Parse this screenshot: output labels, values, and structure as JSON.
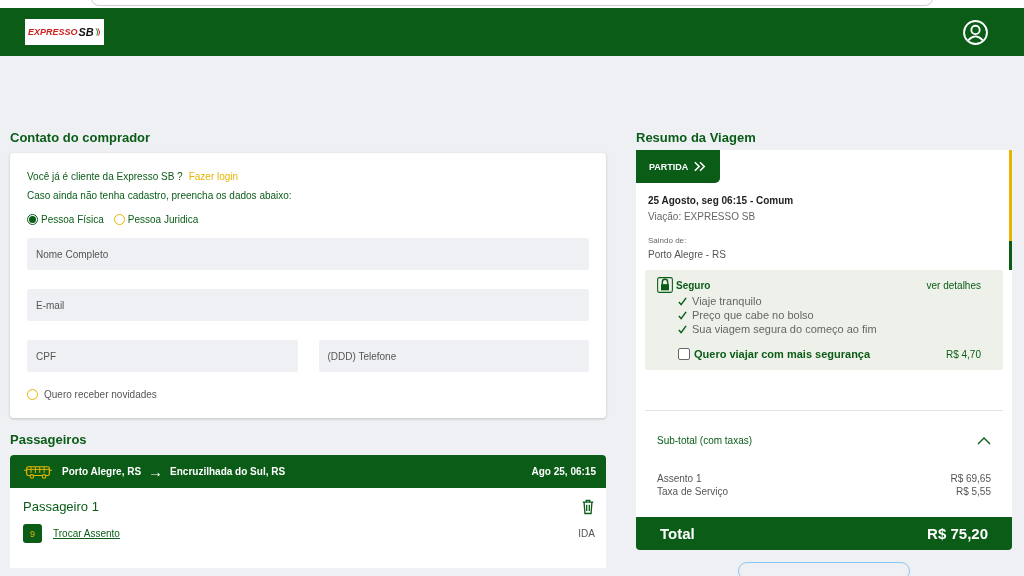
{
  "header": {
    "logo": {
      "word": "EXPRESSO",
      "mark": "SB"
    }
  },
  "buyer": {
    "title": "Contato do comprador",
    "question": "Você já é cliente da Expresso SB ?",
    "login_link": "Fazer login",
    "hint": "Caso ainda não tenha cadastro, preencha os dados abaixo:",
    "person_types": [
      {
        "label": "Pessoa Física",
        "selected": true
      },
      {
        "label": "Pessoa Juridica",
        "selected": false
      }
    ],
    "fields": [
      {
        "placeholder": "Nome Completo"
      },
      {
        "placeholder": "E-mail"
      },
      {
        "placeholder": "CPF"
      },
      {
        "placeholder": "(DDD) Telefone"
      }
    ],
    "newsletter": {
      "label": "Quero receber novidades",
      "checked": false
    }
  },
  "passengers": {
    "title": "Passageiros",
    "route": {
      "from": "Porto Alegre, RS",
      "arrow": "→",
      "to": "Encruzilhada do Sul, RS",
      "date": "Ago 25, 06:15"
    },
    "items": [
      {
        "name": "Passageiro 1",
        "seat": "9",
        "change_seat": "Trocar Assento",
        "direction": "IDA"
      }
    ]
  },
  "summary": {
    "title": "Resumo da Viagem",
    "badge": "PARTIDA",
    "date_line": "25 Agosto, seg 06:15 - Comum",
    "company": "Viação: EXPRESSO SB",
    "from_label": "Saindo de:",
    "from": "Porto Alegre - RS",
    "insurance": {
      "title": "Seguro",
      "details_link": "ver detalhes",
      "benefits": [
        "Viaje tranquilo",
        "Preço que cabe no bolso",
        "Sua viagem segura do começo ao fim"
      ],
      "option": "Quero viajar com mais segurança",
      "checked": false,
      "price": "R$ 4,70"
    },
    "subtotal": {
      "label": "Sub-total (com taxas)",
      "expanded": true,
      "lines": [
        {
          "label": "Assento 1",
          "value": "R$ 69,65"
        },
        {
          "label": "Taxa de Serviço",
          "value": "R$ 5,55"
        }
      ]
    },
    "total": {
      "label": "Total",
      "value": "R$ 75,20"
    }
  }
}
